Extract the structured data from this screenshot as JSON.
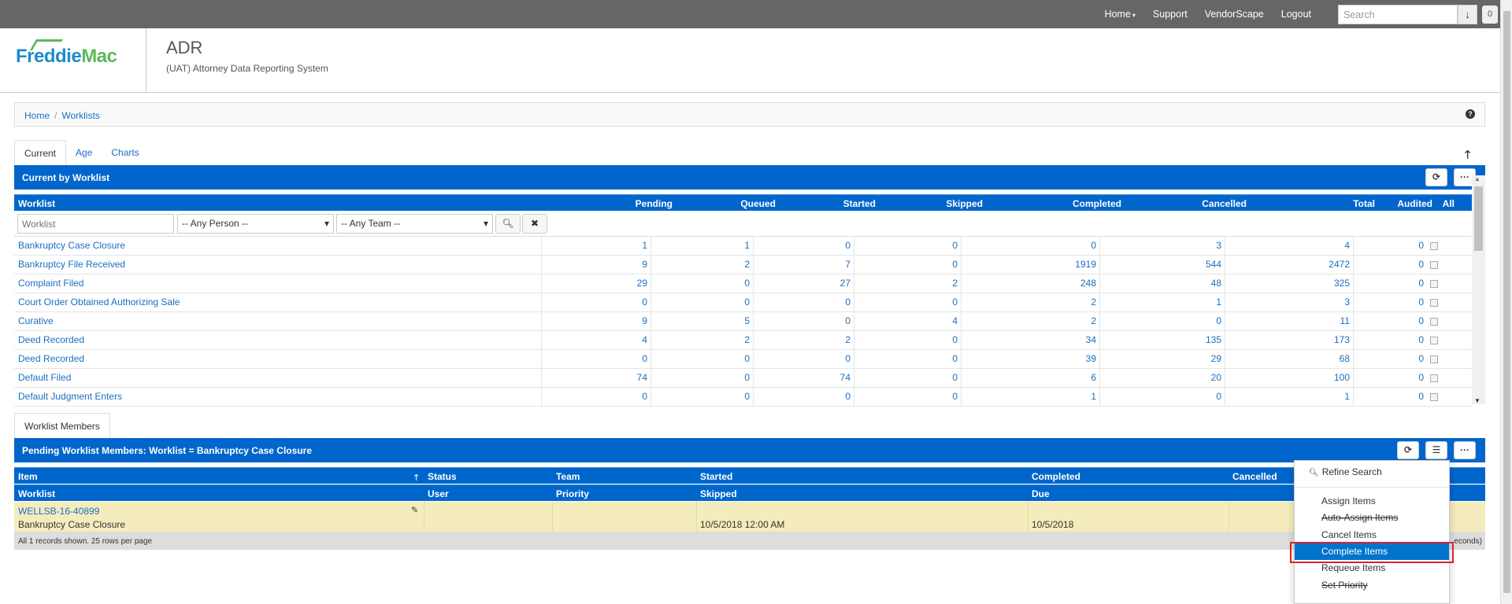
{
  "topnav": {
    "links": [
      {
        "label": "Home",
        "has_caret": true
      },
      {
        "label": "Support"
      },
      {
        "label": "VendorScape"
      },
      {
        "label": "Logout"
      }
    ],
    "search_placeholder": "Search",
    "download_icon": "↓",
    "count": "0"
  },
  "header": {
    "logo_text_1": "Freddie",
    "logo_text_2": "Mac",
    "app_title": "ADR",
    "app_subtitle": "(UAT) Attorney Data Reporting System"
  },
  "breadcrumb": {
    "items": [
      "Home",
      "Worklists"
    ],
    "help": "?"
  },
  "tabs": [
    {
      "label": "Current",
      "active": true
    },
    {
      "label": "Age"
    },
    {
      "label": "Charts"
    }
  ],
  "worklist_panel": {
    "title": "Current by Worklist",
    "columns": [
      "Worklist",
      "Pending",
      "Queued",
      "Started",
      "Skipped",
      "Completed",
      "Cancelled",
      "Total",
      "Audited",
      "All"
    ],
    "filters": {
      "worklist_placeholder": "Worklist",
      "person": "-- Any Person --",
      "team": "-- Any Team --"
    },
    "rows": [
      {
        "name": "Bankruptcy Case Closure",
        "pending": "1",
        "queued": "1",
        "started": "0",
        "skipped": "0",
        "completed": "0",
        "cancelled": "3",
        "total": "4",
        "audited": "0"
      },
      {
        "name": "Bankruptcy File Received",
        "pending": "9",
        "queued": "2",
        "started": "7",
        "skipped": "0",
        "completed": "1919",
        "cancelled": "544",
        "total": "2472",
        "audited": "0"
      },
      {
        "name": "Complaint Filed",
        "pending": "29",
        "queued": "0",
        "started": "27",
        "skipped": "2",
        "completed": "248",
        "cancelled": "48",
        "total": "325",
        "audited": "0"
      },
      {
        "name": "Court Order Obtained Authorizing Sale",
        "pending": "0",
        "queued": "0",
        "started": "0",
        "skipped": "0",
        "completed": "2",
        "cancelled": "1",
        "total": "3",
        "audited": "0"
      },
      {
        "name": "Curative",
        "pending": "9",
        "queued": "5",
        "started": "0",
        "skipped": "4",
        "completed": "2",
        "cancelled": "0",
        "total": "11",
        "audited": "0"
      },
      {
        "name": "Deed Recorded",
        "pending": "4",
        "queued": "2",
        "started": "2",
        "skipped": "0",
        "completed": "34",
        "cancelled": "135",
        "total": "173",
        "audited": "0"
      },
      {
        "name": "Deed Recorded",
        "pending": "0",
        "queued": "0",
        "started": "0",
        "skipped": "0",
        "completed": "39",
        "cancelled": "29",
        "total": "68",
        "audited": "0"
      },
      {
        "name": "Default Filed",
        "pending": "74",
        "queued": "0",
        "started": "74",
        "skipped": "0",
        "completed": "6",
        "cancelled": "20",
        "total": "100",
        "audited": "0"
      },
      {
        "name": "Default Judgment Enters",
        "pending": "0",
        "queued": "0",
        "started": "0",
        "skipped": "0",
        "completed": "1",
        "cancelled": "0",
        "total": "1",
        "audited": "0"
      }
    ]
  },
  "members": {
    "tab_label": "Worklist Members",
    "title": "Pending Worklist Members: Worklist = Bankruptcy Case Closure",
    "header_row1": [
      "Item",
      "Status",
      "Team",
      "Started",
      "Completed",
      "Cancelled"
    ],
    "header_row2": [
      "Worklist",
      "User",
      "Priority",
      "Skipped",
      "Due"
    ],
    "row": {
      "item": "WELLSB-16-40899",
      "worklist": "Bankruptcy Case Closure",
      "skipped": "10/5/2018 12:00 AM",
      "due": "10/5/2018"
    },
    "footer": "All 1 records shown. 25 rows per page",
    "footer_right": "econds)"
  },
  "dropdown": {
    "refine": "Refine Search",
    "items": [
      {
        "label": "Assign Items",
        "strike": false
      },
      {
        "label": "Auto-Assign Items",
        "strike": true
      },
      {
        "label": "Cancel Items",
        "strike": false
      },
      {
        "label": "Complete Items",
        "strike": false,
        "active": true
      },
      {
        "label": "Requeue Items",
        "strike": false
      },
      {
        "label": "Set Priority",
        "strike": true
      }
    ]
  }
}
